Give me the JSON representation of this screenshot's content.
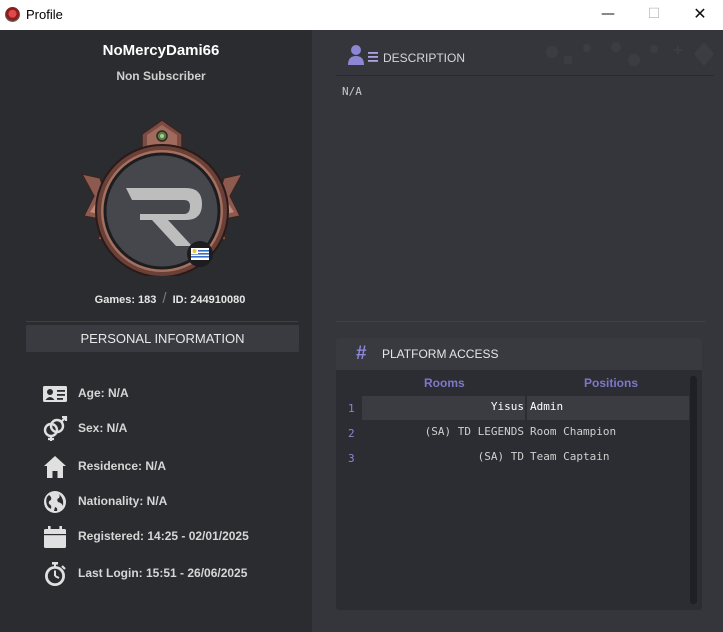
{
  "window": {
    "title": "Profile",
    "controls": {
      "minimize": "—",
      "maximize": "☐",
      "close": "✕"
    }
  },
  "profile": {
    "username": "NoMercyDami66",
    "subscription": "Non Subscriber",
    "badge_icon": "r-logo-emblem",
    "flag_icon": "uruguay-flag",
    "games": "Games: 183",
    "stats_separator": "/",
    "id": "ID: 244910080"
  },
  "personal_information": {
    "title": "PERSONAL INFORMATION",
    "rows": [
      {
        "icon": "id-card-icon",
        "text": "Age: N/A"
      },
      {
        "icon": "gender-icon",
        "text": "Sex: N/A"
      },
      {
        "icon": "home-icon",
        "text": "Residence: N/A"
      },
      {
        "icon": "globe-icon",
        "text": "Nationality: N/A"
      },
      {
        "icon": "calendar-icon",
        "text": "Registered: 14:25 - 02/01/2025"
      },
      {
        "icon": "stopwatch-icon",
        "text": "Last Login: 15:51 - 26/06/2025"
      }
    ]
  },
  "description": {
    "title": "DESCRIPTION",
    "text": "N/A"
  },
  "platform_access": {
    "title": "PLATFORM ACCESS",
    "hash": "#",
    "columns": {
      "rooms": "Rooms",
      "positions": "Positions"
    },
    "rows": [
      {
        "num": "1",
        "room": "Yisus",
        "position": "Admin",
        "selected": true
      },
      {
        "num": "2",
        "room": "(SA) TD LEGENDS",
        "position": "Room Champion",
        "selected": false
      },
      {
        "num": "3",
        "room": "(SA) TD",
        "position": "Team Captain",
        "selected": false
      }
    ]
  },
  "colors": {
    "accent": "#8c87d4",
    "left_bg": "#2b2c30",
    "right_bg": "#35363c",
    "badge_copper": "#8c5a4e"
  }
}
